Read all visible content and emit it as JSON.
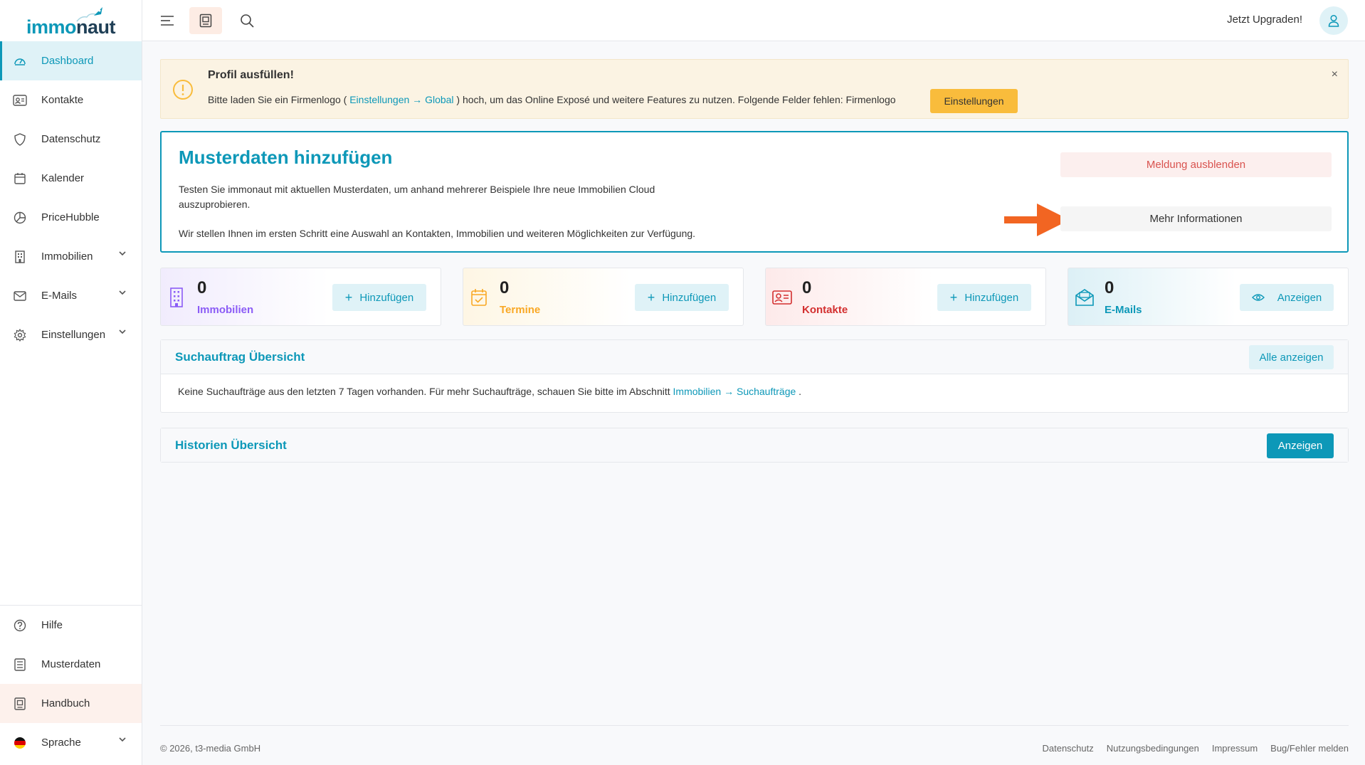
{
  "logo": {
    "part1": "immo",
    "part2": "naut"
  },
  "sidebar": {
    "items": [
      {
        "label": "Dashboard"
      },
      {
        "label": "Kontakte"
      },
      {
        "label": "Datenschutz"
      },
      {
        "label": "Kalender"
      },
      {
        "label": "PriceHubble"
      },
      {
        "label": "Immobilien"
      },
      {
        "label": "E-Mails"
      },
      {
        "label": "Einstellungen"
      }
    ],
    "bottom": [
      {
        "label": "Hilfe"
      },
      {
        "label": "Musterdaten"
      },
      {
        "label": "Handbuch"
      },
      {
        "label": "Sprache"
      }
    ]
  },
  "topbar": {
    "upgrade": "Jetzt Upgraden!"
  },
  "alert": {
    "title": "Profil ausfüllen!",
    "text_before": "Bitte laden Sie ein Firmenlogo ( ",
    "link1": "Einstellungen",
    "arrow": " → ",
    "link2": "Global",
    "text_after": " ) hoch, um das Online Exposé und weitere Features zu nutzen. Folgende Felder fehlen: Firmenlogo",
    "button": "Einstellungen",
    "close": "×"
  },
  "muster": {
    "title": "Musterdaten hinzufügen",
    "p1": "Testen Sie immonaut mit aktuellen Musterdaten, um anhand mehrerer Beispiele Ihre neue Immobilien Cloud auszuprobieren.",
    "p2": "Wir stellen Ihnen im ersten Schritt eine Auswahl an Kontakten, Immobilien und weiteren Möglichkeiten zur Verfügung.",
    "hide_button": "Meldung ausblenden",
    "more_button": "Mehr Informationen"
  },
  "stats": [
    {
      "count": "0",
      "label": "Immobilien",
      "button": "Hinzufügen",
      "color": "#8b5cf6"
    },
    {
      "count": "0",
      "label": "Termine",
      "button": "Hinzufügen",
      "color": "#f9a825"
    },
    {
      "count": "0",
      "label": "Kontakte",
      "button": "Hinzufügen",
      "color": "#d32f2f"
    },
    {
      "count": "0",
      "label": "E-Mails",
      "button": "Anzeigen",
      "color": "#0d98b8"
    }
  ],
  "such": {
    "title": "Suchauftrag Übersicht",
    "button": "Alle anzeigen",
    "text": "Keine Suchaufträge aus den letzten 7 Tagen vorhanden. Für mehr Suchaufträge, schauen Sie bitte im Abschnitt ",
    "link": "Immobilien → Suchaufträge",
    "end": " ."
  },
  "historien": {
    "title": "Historien Übersicht",
    "button": "Anzeigen"
  },
  "footer": {
    "copyright": "© 2026, t3-media GmbH",
    "links": [
      "Datenschutz",
      "Nutzungsbedingungen",
      "Impressum",
      "Bug/Fehler melden"
    ]
  },
  "colors": {
    "accent": "#0d98b8",
    "warning": "#f9bc3c",
    "danger": "#d9534f",
    "arrow": "#f26522"
  }
}
